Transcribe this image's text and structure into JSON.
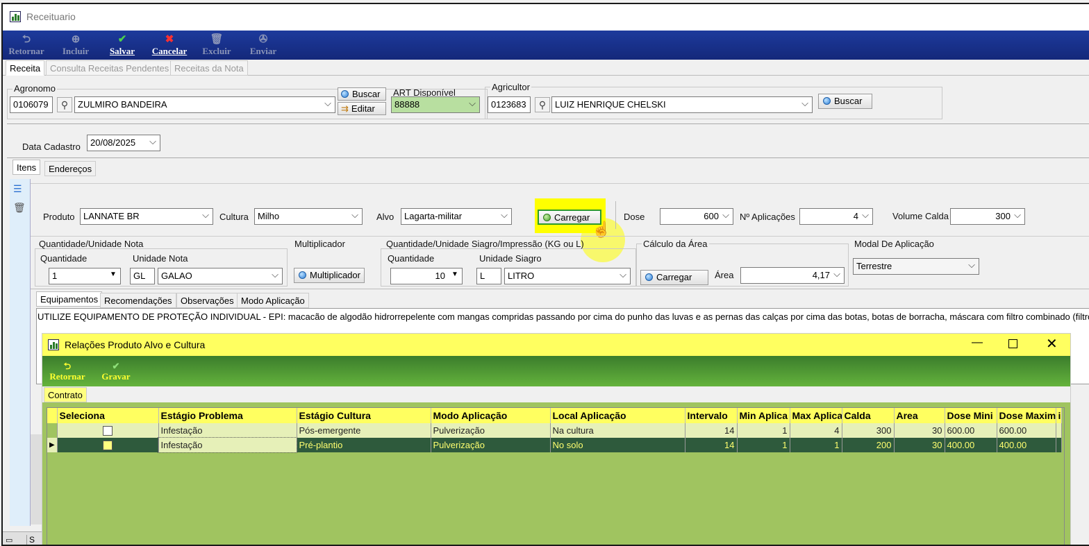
{
  "window": {
    "title": "Receituario"
  },
  "toolbar": [
    {
      "label": "Retornar",
      "icon": "return-icon",
      "enabled": false
    },
    {
      "label": "Incluir",
      "icon": "add-icon",
      "enabled": false
    },
    {
      "label": "Salvar",
      "icon": "check-icon",
      "enabled": true
    },
    {
      "label": "Cancelar",
      "icon": "cancel-icon",
      "enabled": true
    },
    {
      "label": "Excluir",
      "icon": "trash-icon",
      "enabled": false
    },
    {
      "label": "Enviar",
      "icon": "send-icon",
      "enabled": false
    }
  ],
  "tabs": [
    "Receita",
    "Consulta Receitas Pendentes",
    "Receitas da Nota"
  ],
  "agronomo": {
    "label": "Agronomo",
    "code": "0106079",
    "name": "ZULMIRO BANDEIRA",
    "buscar": "Buscar",
    "editar": "Editar"
  },
  "art": {
    "label": "ART Disponível",
    "value": "88888"
  },
  "agricultor": {
    "label": "Agricultor",
    "code": "0123683",
    "name": "LUIZ HENRIQUE CHELSKI",
    "buscar": "Buscar"
  },
  "data_cadastro": {
    "label": "Data Cadastro",
    "value": "20/08/2025"
  },
  "subtabs": [
    "Itens",
    "Endereços"
  ],
  "produto": {
    "label": "Produto",
    "value": "LANNATE BR"
  },
  "cultura": {
    "label": "Cultura",
    "value": "Milho"
  },
  "alvo": {
    "label": "Alvo",
    "value": "Lagarta-militar"
  },
  "carregar": "Carregar",
  "dose": {
    "label": "Dose",
    "value": "600"
  },
  "aplicacoes": {
    "label": "Nº Aplicações",
    "value": "4"
  },
  "volume": {
    "label": "Volume Calda",
    "value": "300"
  },
  "qtd_nota": {
    "group": "Quantidade/Unidade Nota",
    "qtd_label": "Quantidade",
    "qtd": "1",
    "un_label": "Unidade Nota",
    "un_code": "GL",
    "un_name": "GALAO"
  },
  "multiplicador": {
    "group": "Multiplicador",
    "button": "Multiplicador"
  },
  "qtd_siagro": {
    "group": "Quantidade/Unidade Siagro/Impressão (KG ou L)",
    "qtd_label": "Quantidade",
    "qtd": "10",
    "un_label": "Unidade Siagro",
    "un_code": "L",
    "un_name": "LITRO"
  },
  "area": {
    "group": "Cálculo da Área",
    "button": "Carregar",
    "label": "Área",
    "value": "4,17"
  },
  "modal": {
    "group": "Modal De Aplicação",
    "value": "Terrestre"
  },
  "subtabs2": [
    "Equipamentos",
    "Recomendações",
    "Observações",
    "Modo Aplicação"
  ],
  "epi_text": "UTILIZE EQUIPAMENTO DE PROTEÇÃO INDIVIDUAL - EPI: macacão de algodão hidrorrepelente com mangas compridas passando por cima do punho das luvas e as pernas das calças por cima das botas, botas de borracha, máscara com filtro combinado (filtro químico",
  "dialog": {
    "title": "Relações Produto Alvo e Cultura",
    "toolbar": [
      {
        "label": "Retornar",
        "icon": "return-icon"
      },
      {
        "label": "Gravar",
        "icon": "check-icon"
      }
    ],
    "tab": "Contrato",
    "columns": [
      "Seleciona",
      "Estágio Problema",
      "Estágio Cultura",
      "Modo Aplicação",
      "Local Aplicação",
      "Intervalo",
      "Min Aplica",
      "Max Aplica",
      "Calda",
      "Area",
      "Dose Mini",
      "Dose Maxim",
      "i"
    ],
    "rows": [
      {
        "selected": false,
        "estagio_problema": "Infestação",
        "estagio_cultura": "Pós-emergente",
        "modo": "Pulverização",
        "local": "Na cultura",
        "intervalo": "14",
        "min": "1",
        "max": "4",
        "calda": "300",
        "area": "30",
        "dose_min": "600.00",
        "dose_max": "600.00"
      },
      {
        "selected": true,
        "estagio_problema": "Infestação",
        "estagio_cultura": "Pré-plantio",
        "modo": "Pulverização",
        "local": "No solo",
        "intervalo": "14",
        "min": "1",
        "max": "1",
        "calda": "200",
        "area": "30",
        "dose_min": "400.00",
        "dose_max": "400.00"
      }
    ]
  },
  "colors": {
    "toolbar": "#1d3a9c",
    "dialog_title": "#ffff60",
    "dialog_toolbar": "#4f9a34",
    "grid_bg": "#a0c460",
    "selected_row": "#2e5a3c"
  }
}
